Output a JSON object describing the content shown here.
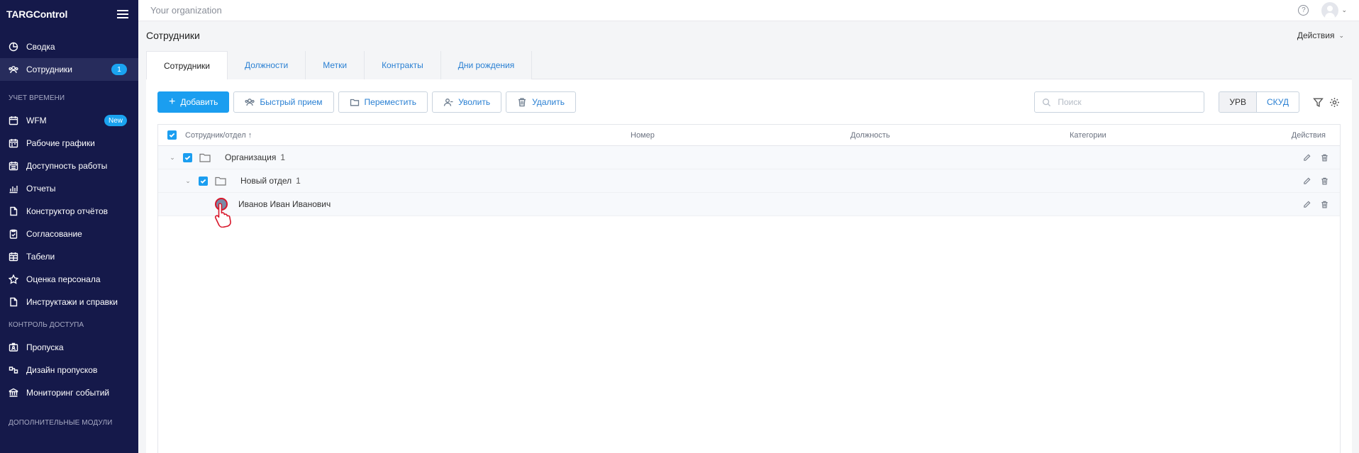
{
  "sidebar": {
    "logo": "TARGControl",
    "items_top": [
      {
        "label": "Сводка",
        "icon": "chart-pie-icon"
      },
      {
        "label": "Сотрудники",
        "icon": "users-icon",
        "badge": "1",
        "active": true
      }
    ],
    "section_time": "Учет времени",
    "items_time": [
      {
        "label": "WFM",
        "icon": "calendar-icon",
        "badge": "New"
      },
      {
        "label": "Рабочие графики",
        "icon": "calendar-icon"
      },
      {
        "label": "Доступность работы",
        "icon": "calendar-icon"
      },
      {
        "label": "Отчеты",
        "icon": "bar-chart-icon"
      },
      {
        "label": "Конструктор отчётов",
        "icon": "document-icon"
      },
      {
        "label": "Согласование",
        "icon": "clipboard-check-icon"
      },
      {
        "label": "Табели",
        "icon": "calendar-grid-icon"
      },
      {
        "label": "Оценка персонала",
        "icon": "star-icon"
      },
      {
        "label": "Инструктажи и справки",
        "icon": "document-icon"
      }
    ],
    "section_access": "Контроль доступа",
    "items_access": [
      {
        "label": "Пропуска",
        "icon": "badge-card-icon"
      },
      {
        "label": "Дизайн пропусков",
        "icon": "design-icon"
      },
      {
        "label": "Мониторинг событий",
        "icon": "monitor-icon"
      }
    ],
    "section_modules": "Дополнительные модули"
  },
  "topbar": {
    "organization": "Your organization",
    "help_glyph": "?"
  },
  "page": {
    "title": "Сотрудники",
    "actions_label": "Действия"
  },
  "tabs": [
    {
      "label": "Сотрудники",
      "active": true
    },
    {
      "label": "Должности"
    },
    {
      "label": "Метки"
    },
    {
      "label": "Контракты"
    },
    {
      "label": "Дни рождения"
    }
  ],
  "toolbar": {
    "add_label": "Добавить",
    "quick_label": "Быстрый прием",
    "move_label": "Переместить",
    "dismiss_label": "Уволить",
    "delete_label": "Удалить",
    "search_placeholder": "Поиск",
    "seg_urv": "УРВ",
    "seg_skud": "СКУД"
  },
  "table": {
    "columns": {
      "employee": "Сотрудник/отдел ↑",
      "number": "Номер",
      "position": "Должность",
      "categories": "Категории",
      "actions": "Действия"
    },
    "rows": [
      {
        "type": "org",
        "name": "Организация",
        "count": "1"
      },
      {
        "type": "dept",
        "name": "Новый отдел",
        "count": "1"
      },
      {
        "type": "employee",
        "name": "Иванов Иван Иванович"
      }
    ]
  },
  "colors": {
    "sidebar_bg": "#15194a",
    "accent": "#1b9ef0",
    "link": "#2a80d3"
  }
}
